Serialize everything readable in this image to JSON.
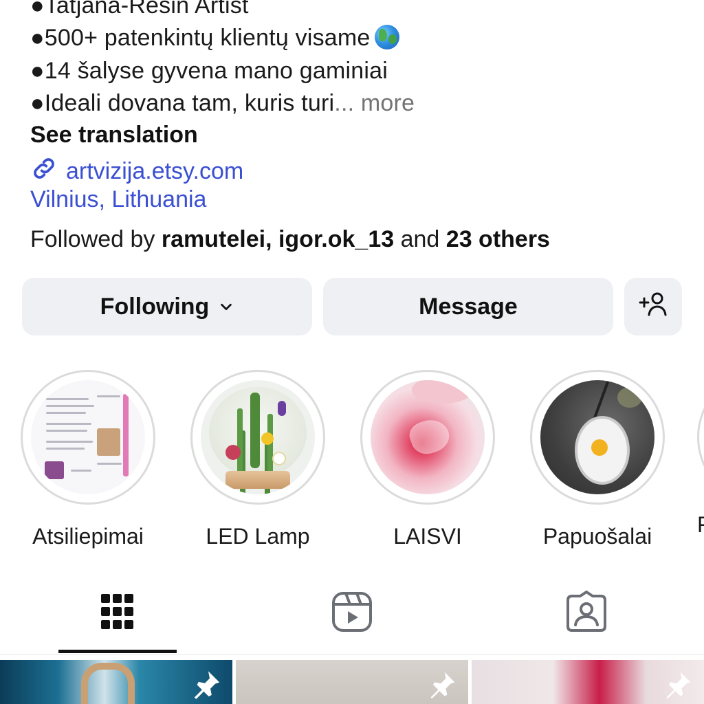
{
  "bio": {
    "lines": [
      "●Tatjana-Resin Artist",
      "●500+ patenkintų klientų visame",
      "●14 šalyse gyvena mano gaminiai",
      "●Ideali dovana tam, kuris turi"
    ],
    "ellipsis": "...",
    "more_label": "more",
    "see_translation": "See translation",
    "link_text": "artvizija.etsy.com",
    "location": "Vilnius, Lithuania"
  },
  "followed": {
    "prefix": "Followed by ",
    "user1": "ramutelei",
    "separator": ", ",
    "user2": "igor.ok_13",
    "conjunction": " and ",
    "others": "23 others"
  },
  "actions": {
    "following_label": "Following",
    "message_label": "Message",
    "add_user_icon": "person-add-icon"
  },
  "highlights": [
    {
      "label": "Atsiliepimai"
    },
    {
      "label": "LED Lamp"
    },
    {
      "label": "LAISVI"
    },
    {
      "label": "Papuošalai"
    },
    {
      "label": "F"
    }
  ],
  "tabs": [
    {
      "icon": "grid-icon",
      "active": true
    },
    {
      "icon": "reels-icon",
      "active": false
    },
    {
      "icon": "tagged-icon",
      "active": false
    }
  ],
  "colors": {
    "link": "#3a4fd1",
    "button_bg": "#eef0f3",
    "muted": "#737373",
    "active_tab": "#111111",
    "inactive_tab": "#6b6f75"
  }
}
